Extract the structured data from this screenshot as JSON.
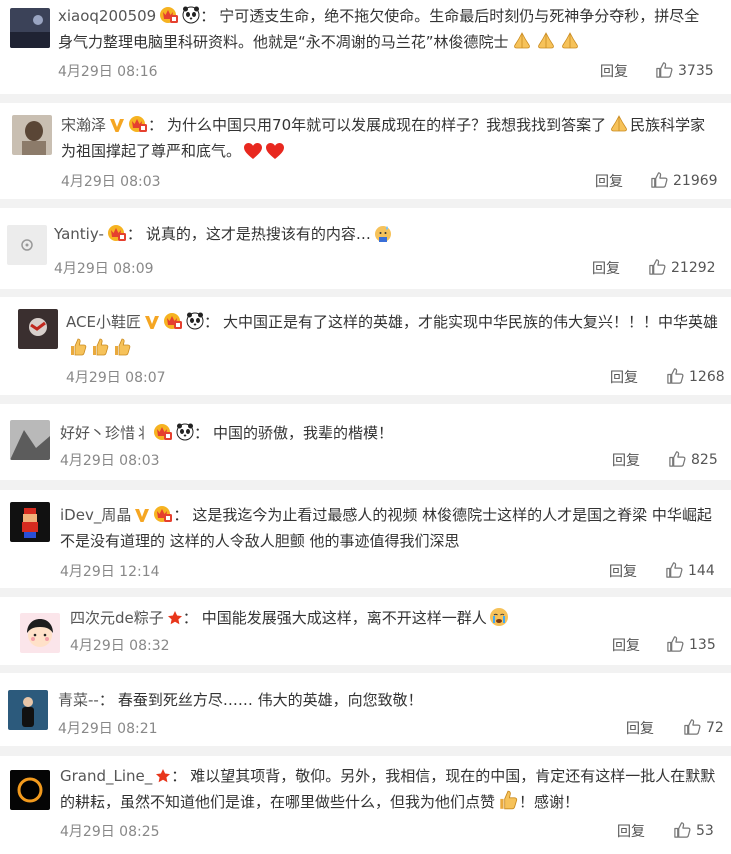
{
  "reply_label": "回复",
  "comments": [
    {
      "username": "xiaoq200509",
      "text": "宁可透支生命，绝不拖欠使命。生命最后时刻仍与死神争分夺秒，拼尽全身气力整理电脑里科研资料。他就是“永不凋谢的马兰花”林俊德院士",
      "time": "4月29日 08:16",
      "likes": "3735",
      "avatar_icon": "dark-landscape-avatar"
    },
    {
      "username": "宋瀚泽",
      "text": "为什么中国只用70年就可以发展成现在的样子？我想我找到答案了",
      "text2": "民族科学家为祖国撑起了尊严和底气。",
      "time": "4月29日 08:03",
      "likes": "21969",
      "avatar_icon": "portrait-avatar"
    },
    {
      "username": "Yantiy-",
      "text": "说真的，这才是热搜该有的内容…",
      "time": "4月29日 08:09",
      "likes": "21292",
      "avatar_icon": "default-avatar"
    },
    {
      "username": "ACE小鞋匠",
      "text": "大中国正是有了这样的英雄，才能实现中华民族的伟大复兴！！！中华英雄",
      "time": "4月29日 08:07",
      "likes": "1268",
      "avatar_icon": "red-figure-avatar"
    },
    {
      "username": "好好丶珍惜丬",
      "text": "中国的骄傲，我辈的楷模！",
      "time": "4月29日 08:03",
      "likes": "825",
      "avatar_icon": "bw-photo-avatar"
    },
    {
      "username": "iDev_周晶",
      "text": "这是我迄今为止看过最感人的视频 林俊德院士这样的人才是国之脊梁 中华崛起不是没有道理的 这样的人令敌人胆颤 他的事迹值得我们深思",
      "time": "4月29日 12:14",
      "likes": "144",
      "avatar_icon": "pixel-mario-avatar"
    },
    {
      "username": "四次元de粽子",
      "text": "中国能发展强大成这样，离不开这样一群人",
      "time": "4月29日 08:32",
      "likes": "135",
      "avatar_icon": "cartoon-girl-avatar"
    },
    {
      "username": "青菜--",
      "text": "春蚕到死丝方尽…… 伟大的英雄，向您致敬！",
      "time": "4月29日 08:21",
      "likes": "72",
      "avatar_icon": "person-standing-avatar"
    },
    {
      "username": "Grand_Line_",
      "text": "难以望其项背，敬仰。另外，我相信，现在的中国，肯定还有这样一批人在默默的耕耘，虽然不知道他们是谁，在哪里做些什么，但我为他们点赞",
      "text_end": "！感谢！",
      "time": "4月29日 08:25",
      "likes": "53",
      "avatar_icon": "eclipse-ring-avatar"
    }
  ]
}
